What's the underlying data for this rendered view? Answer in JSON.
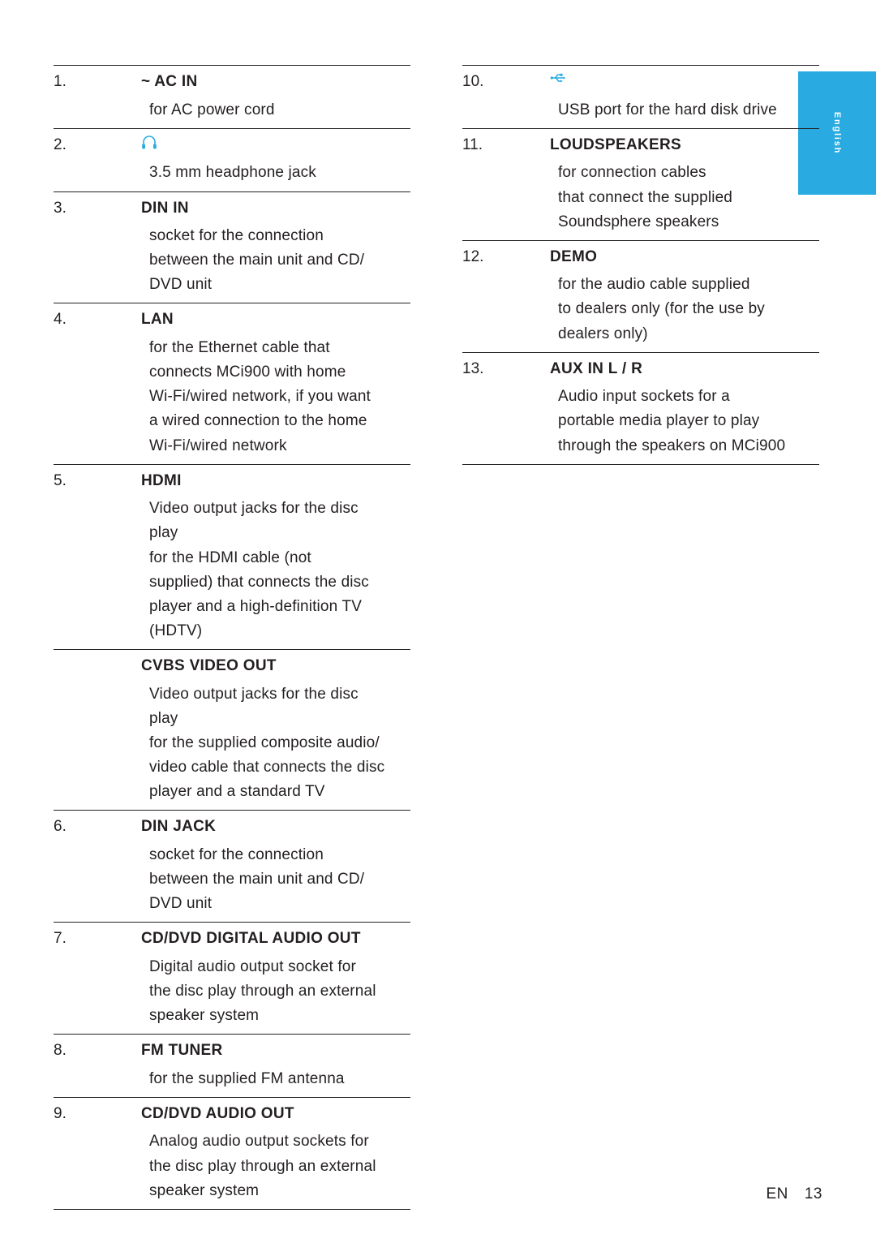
{
  "side_tab": {
    "label": "English",
    "color": "#29abe2"
  },
  "footer": {
    "lang_code": "EN",
    "page_number": "13"
  },
  "left_column": [
    {
      "number": "1.",
      "label": "~ AC IN",
      "icon": null,
      "desc": [
        "for AC power cord"
      ]
    },
    {
      "number": "2.",
      "label": null,
      "icon": "headphone-icon",
      "desc": [
        "3.5 mm headphone jack"
      ]
    },
    {
      "number": "3.",
      "label": "DIN IN",
      "icon": null,
      "desc": [
        "socket for the connection",
        "between the main unit and CD/",
        "DVD unit"
      ]
    },
    {
      "number": "4.",
      "label": "LAN",
      "icon": null,
      "desc": [
        "for the Ethernet cable that",
        "connects MCi900 with home",
        "Wi-Fi/wired network, if you want",
        "a wired connection to the home",
        "Wi-Fi/wired network"
      ]
    },
    {
      "number": "5.",
      "label": "HDMI",
      "icon": null,
      "desc": [
        "Video output jacks for the disc",
        "play",
        "for the HDMI cable (not",
        "supplied) that connects the disc",
        "player and a high-definition TV",
        "(HDTV)"
      ]
    },
    {
      "number": "",
      "label": "CVBS VIDEO OUT",
      "icon": null,
      "desc": [
        "Video output jacks for the disc",
        "play",
        "for the supplied composite audio/",
        "video cable that connects the disc",
        "player and a standard TV"
      ]
    },
    {
      "number": "6.",
      "label": "DIN JACK",
      "icon": null,
      "desc": [
        "socket for the connection",
        "between the main unit and CD/",
        "DVD unit"
      ]
    },
    {
      "number": "7.",
      "label": "CD/DVD DIGITAL AUDIO OUT",
      "icon": null,
      "desc": [
        "Digital audio output socket for",
        "the disc play through an external",
        "speaker system"
      ]
    },
    {
      "number": "8.",
      "label": "FM TUNER",
      "icon": null,
      "desc": [
        "for the supplied FM antenna"
      ]
    },
    {
      "number": "9.",
      "label": "CD/DVD AUDIO OUT",
      "icon": null,
      "desc": [
        "Analog audio output sockets for",
        "the disc play through an external",
        "speaker system"
      ]
    }
  ],
  "right_column": [
    {
      "number": "10.",
      "label": null,
      "icon": "usb-icon",
      "desc": [
        "USB port for the hard disk drive"
      ]
    },
    {
      "number": "11.",
      "label": "LOUDSPEAKERS",
      "icon": null,
      "desc": [
        "for connection cables",
        "that connect the supplied",
        "Soundsphere speakers"
      ]
    },
    {
      "number": "12.",
      "label": "DEMO",
      "icon": null,
      "desc": [
        "for the audio cable supplied",
        "to dealers only (for the use by",
        "dealers only)"
      ]
    },
    {
      "number": "13.",
      "label": "AUX IN L / R",
      "icon": null,
      "desc": [
        "Audio input sockets for a",
        "portable media player to play",
        "through the speakers on MCi900"
      ]
    }
  ]
}
